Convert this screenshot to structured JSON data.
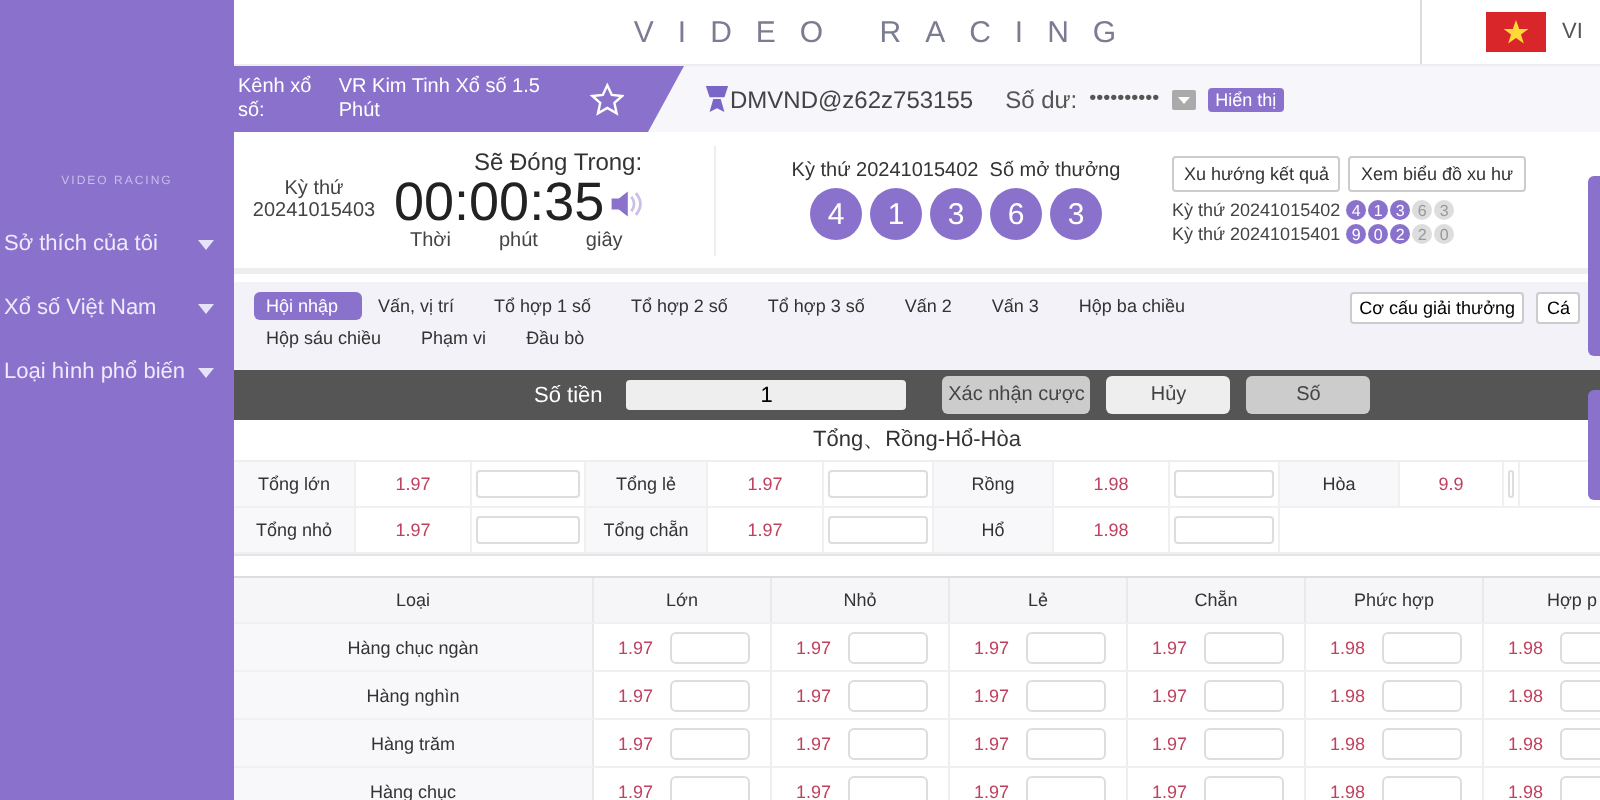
{
  "sidebar": {
    "caption": "VIDEO RACING",
    "items": [
      {
        "label": "Sở thích của tôi",
        "expanded": false
      },
      {
        "label": "Xổ số Việt Nam",
        "expanded": false
      },
      {
        "label": "Loại hình phổ biến",
        "expanded": false
      }
    ]
  },
  "header": {
    "title": "VIDEO RACING",
    "language": "VI"
  },
  "channel": {
    "label": "Kênh xổ số:",
    "name": "VR Kim Tinh Xổ số 1.5 Phút",
    "favorite": false
  },
  "account": {
    "user": "DMVND@z62z753155",
    "balance_label": "Số dư:",
    "balance": "••••••••••",
    "show_button": "Hiển thị"
  },
  "countdown": {
    "round_label": "Kỳ thứ",
    "round": "20241015403",
    "heading": "Sẽ Đóng Trong:",
    "time": "00:00:35",
    "units": [
      "Thời",
      "phút",
      "giây"
    ],
    "sound": true
  },
  "last_draw": {
    "caption": "Kỳ thứ 20241015402  Số mở thưởng",
    "numbers": [
      "4",
      "1",
      "3",
      "6",
      "3"
    ]
  },
  "trend_buttons": [
    "Xu hướng kết quả",
    "Xem biểu đồ xu hư"
  ],
  "history": [
    {
      "round": "Kỳ thứ 20241015402",
      "balls": [
        {
          "n": "4",
          "highlighted": true
        },
        {
          "n": "1",
          "highlighted": true
        },
        {
          "n": "3",
          "highlighted": true
        },
        {
          "n": "6",
          "highlighted": false
        },
        {
          "n": "3",
          "highlighted": false
        }
      ]
    },
    {
      "round": "Kỳ thứ 20241015401",
      "balls": [
        {
          "n": "9",
          "highlighted": true
        },
        {
          "n": "0",
          "highlighted": true
        },
        {
          "n": "2",
          "highlighted": true
        },
        {
          "n": "2",
          "highlighted": false
        },
        {
          "n": "0",
          "highlighted": false
        }
      ]
    }
  ],
  "bet_tabs": [
    {
      "label": "Hội nhập",
      "selected": true
    },
    {
      "label": "Vấn, vị trí",
      "selected": false
    },
    {
      "label": "Tổ hợp 1 số",
      "selected": false
    },
    {
      "label": "Tổ hợp 2 số",
      "selected": false
    },
    {
      "label": "Tổ hợp 3 số",
      "selected": false
    },
    {
      "label": "Vấn 2",
      "selected": false
    },
    {
      "label": "Vấn 3",
      "selected": false
    },
    {
      "label": "Hộp ba chiều",
      "selected": false
    },
    {
      "label": "Hộp sáu chiều",
      "selected": false
    },
    {
      "label": "Phạm vi",
      "selected": false
    },
    {
      "label": "Đầu bò",
      "selected": false
    }
  ],
  "tab_buttons": [
    "Cơ cấu giải thưởng",
    "Cá"
  ],
  "bet_bar": {
    "amount_label": "Số tiền",
    "amount": "1",
    "buttons": [
      "Xác nhận cược",
      "Hủy",
      "Số"
    ]
  },
  "sum_table": {
    "title": "Tổng、Rồng-Hổ-Hòa",
    "rows": [
      [
        {
          "label": "Tổng lớn",
          "odds": "1.97"
        },
        {
          "label": "Tổng lẻ",
          "odds": "1.97"
        },
        {
          "label": "Rồng",
          "odds": "1.98"
        },
        {
          "label": "Hòa",
          "odds": "9.9"
        }
      ],
      [
        {
          "label": "Tổng nhỏ",
          "odds": "1.97"
        },
        {
          "label": "Tổng chẵn",
          "odds": "1.97"
        },
        {
          "label": "Hổ",
          "odds": "1.98"
        }
      ]
    ]
  },
  "position_table": {
    "columns": [
      "Loại",
      "Lớn",
      "Nhỏ",
      "Lẻ",
      "Chẵn",
      "Phức hợp",
      "Hợp p"
    ],
    "rows": [
      {
        "name": "Hàng chục ngàn",
        "odds": [
          "1.97",
          "1.97",
          "1.97",
          "1.97",
          "1.98",
          "1.98"
        ]
      },
      {
        "name": "Hàng nghìn",
        "odds": [
          "1.97",
          "1.97",
          "1.97",
          "1.97",
          "1.98",
          "1.98"
        ]
      },
      {
        "name": "Hàng trăm",
        "odds": [
          "1.97",
          "1.97",
          "1.97",
          "1.97",
          "1.98",
          "1.98"
        ]
      },
      {
        "name": "Hàng chục",
        "odds": [
          "1.97",
          "1.97",
          "1.97",
          "1.97",
          "1.98",
          "1.98"
        ]
      }
    ]
  }
}
